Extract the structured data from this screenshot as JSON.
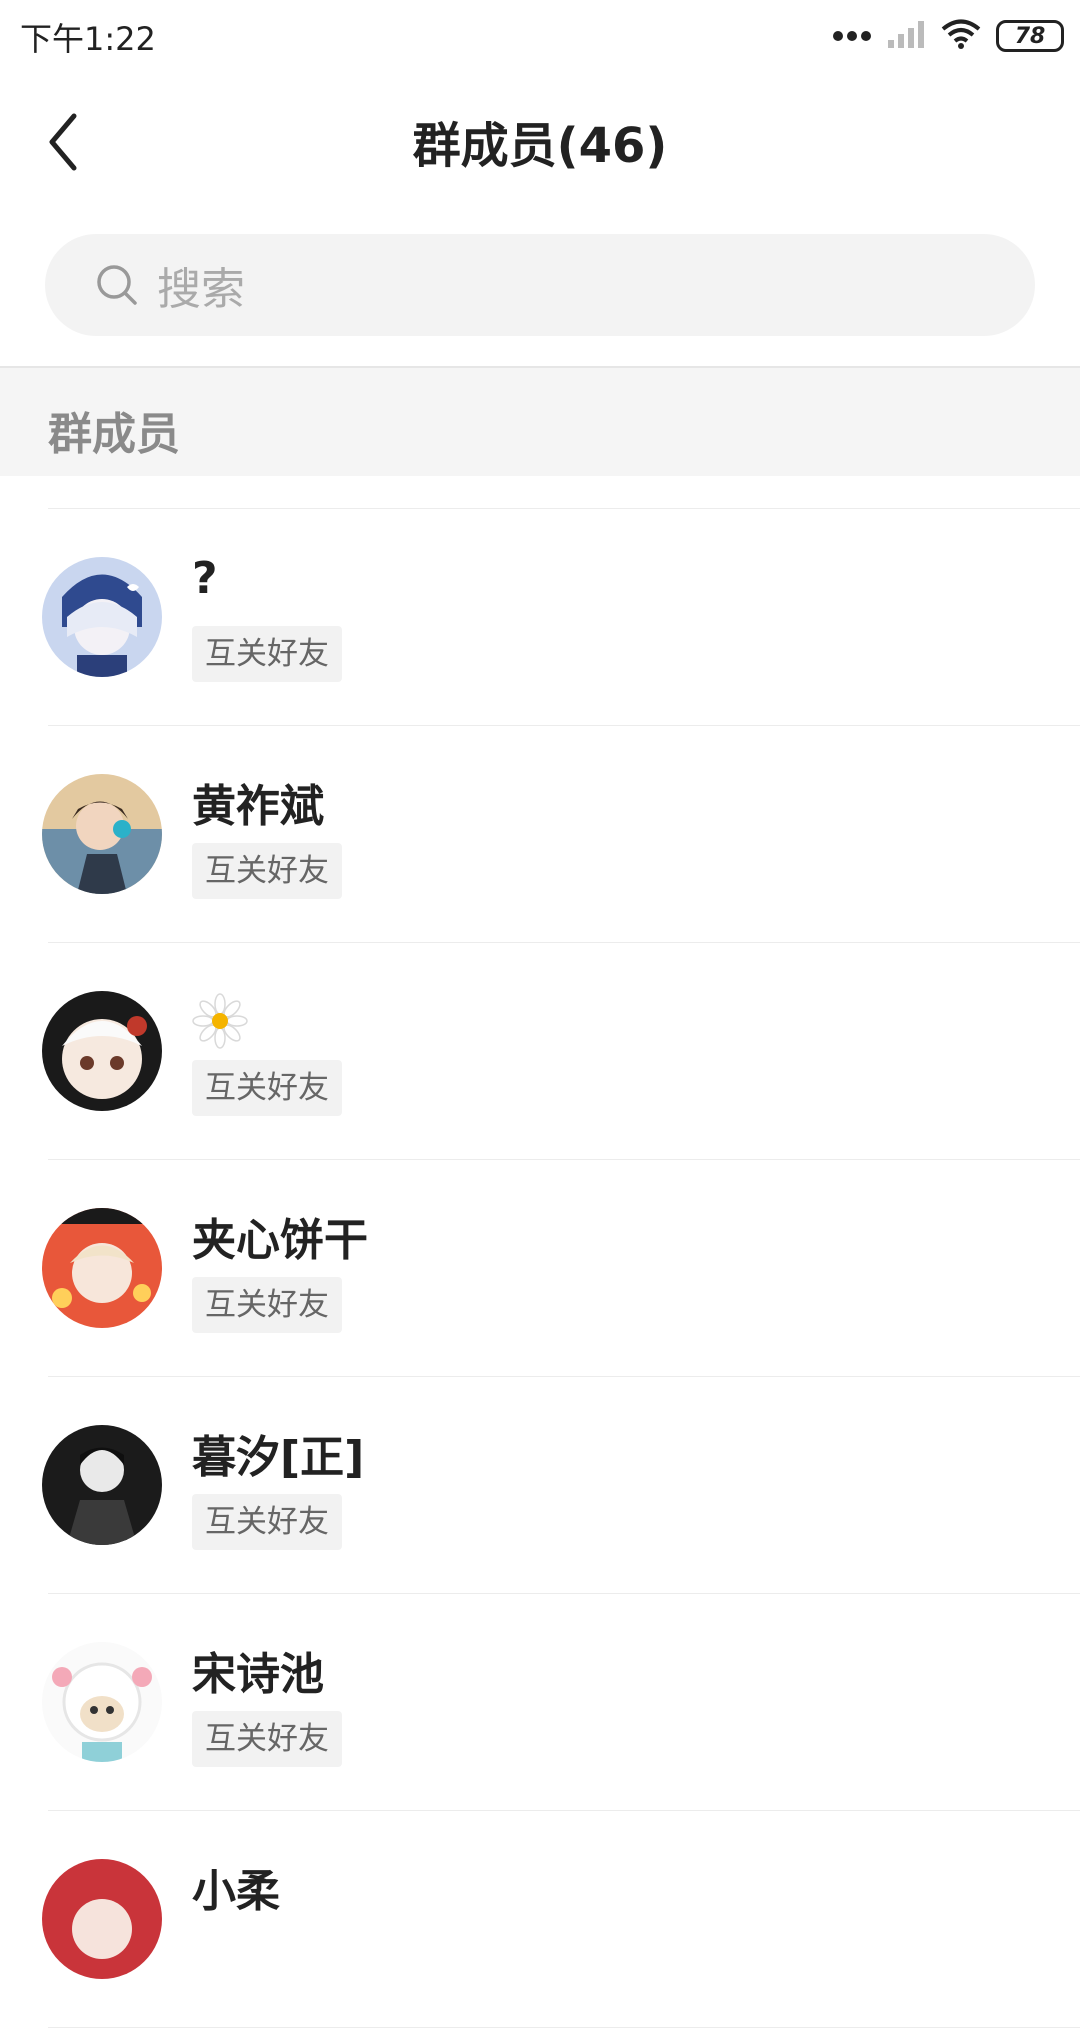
{
  "status_bar": {
    "time": "下午1:22",
    "battery": "78"
  },
  "header": {
    "title": "群成员(46)"
  },
  "search": {
    "placeholder": "搜索"
  },
  "section": {
    "title": "群成员"
  },
  "members": [
    {
      "name": "?",
      "tag": "互关好友",
      "avatar_icon": "anime-girl-blue-avatar"
    },
    {
      "name": "黄祚斌",
      "tag": "互关好友",
      "avatar_icon": "anime-boy-headphones-avatar"
    },
    {
      "name": "",
      "name_icon": "daisy-flower-icon",
      "tag": "互关好友",
      "avatar_icon": "panda-hood-avatar"
    },
    {
      "name": "夹心饼干",
      "tag": "互关好友",
      "avatar_icon": "anime-girl-red-festive-avatar"
    },
    {
      "name": "暮汐[正]",
      "tag": "互关好友",
      "avatar_icon": "dark-portrait-avatar"
    },
    {
      "name": "宋诗池",
      "tag": "互关好友",
      "avatar_icon": "cartoon-sheep-avatar"
    },
    {
      "name": "小柔",
      "tag": "",
      "avatar_icon": "red-avatar"
    }
  ]
}
